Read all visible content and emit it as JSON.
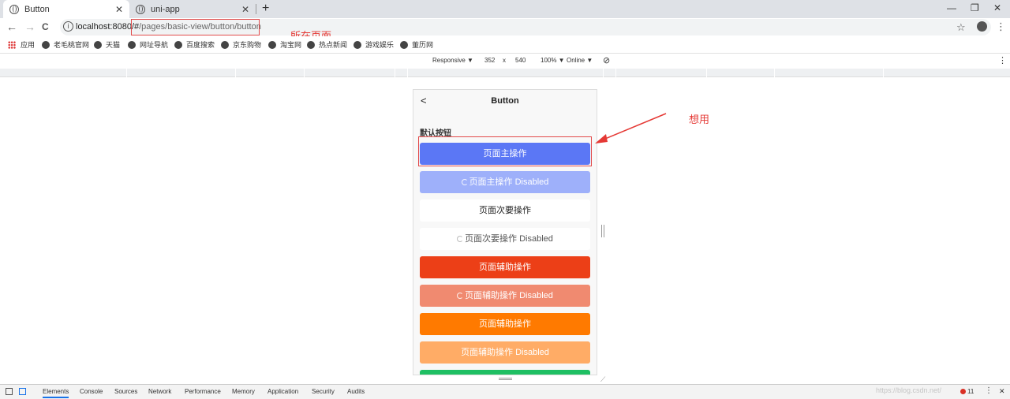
{
  "browser": {
    "tabs": [
      {
        "title": "Button",
        "close": "✕"
      },
      {
        "title": "uni-app",
        "close": "✕"
      }
    ],
    "new_tab": "+",
    "window_controls": [
      "—",
      "❐",
      "✕"
    ],
    "url_host": "localhost:8080/#",
    "url_path": "/pages/basic-view/button/button",
    "nav": {
      "back": "←",
      "forward": "→",
      "reload": "C"
    },
    "info_icon": "i",
    "star": "☆",
    "menu": "⋮"
  },
  "bookmarks": [
    "应用",
    "老毛桃官网",
    "天猫",
    "网址导航",
    "百度搜索",
    "京东购物",
    "淘宝网",
    "热点新闻",
    "游戏娱乐",
    "董历网"
  ],
  "device_toolbar": {
    "device": "Responsive ▼",
    "width": "352",
    "times": "x",
    "height": "540",
    "zoom": "100% ▼",
    "throttle": "Online ▼",
    "rotate": "⊘",
    "menu": "⋮"
  },
  "app": {
    "back": "<",
    "title": "Button",
    "section_title": "默认按钮",
    "buttons": [
      {
        "label": "页面主操作",
        "color": "#5b77f5",
        "loading": false,
        "text_color": "#ffffff"
      },
      {
        "label": "页面主操作 Disabled",
        "color": "#9eb0fa",
        "loading": true,
        "text_color": "#ffffff"
      },
      {
        "label": "页面次要操作",
        "color": "#ffffff",
        "loading": false,
        "text_color": "#222222"
      },
      {
        "label": "页面次要操作 Disabled",
        "color": "#ffffff",
        "loading": true,
        "text_color": "#555555"
      },
      {
        "label": "页面辅助操作",
        "color": "#ec3f17",
        "loading": false,
        "text_color": "#ffffff"
      },
      {
        "label": "页面辅助操作 Disabled",
        "color": "#f08a70",
        "loading": true,
        "text_color": "#ffffff"
      },
      {
        "label": "页面辅助操作",
        "color": "#ff7a00",
        "loading": false,
        "text_color": "#ffffff"
      },
      {
        "label": "页面辅助操作 Disabled",
        "color": "#ffac66",
        "loading": false,
        "text_color": "#ffffff"
      },
      {
        "label": "",
        "color": "#1fbf63",
        "loading": false,
        "text_color": "#ffffff"
      }
    ]
  },
  "annotations": {
    "url_note": "所在页面",
    "button_note": "想用",
    "color": "#e53935"
  },
  "devtools": {
    "tabs": [
      "Elements",
      "Console",
      "Sources",
      "Network",
      "Performance",
      "Memory",
      "Application",
      "Security",
      "Audits"
    ],
    "active_tab": "Elements",
    "errors": "11",
    "menu": "⋮",
    "close": "✕"
  },
  "watermark": "https://blog.csdn.net/"
}
